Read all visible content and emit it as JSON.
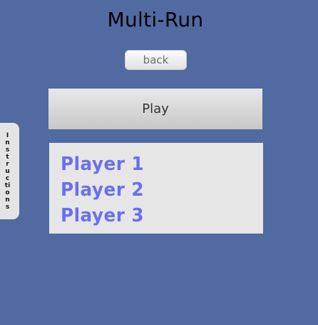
{
  "header": {
    "title": "Multi-Run"
  },
  "controls": {
    "back_label": "back",
    "play_label": "Play"
  },
  "players": [
    {
      "label": "Player 1"
    },
    {
      "label": "Player 2"
    },
    {
      "label": "Player 3"
    }
  ],
  "sidebar": {
    "instructions_label": "Instructions"
  },
  "colors": {
    "background": "#516aa1",
    "player_text": "#6a6ff0",
    "panel_background": "#e6e6e6"
  }
}
